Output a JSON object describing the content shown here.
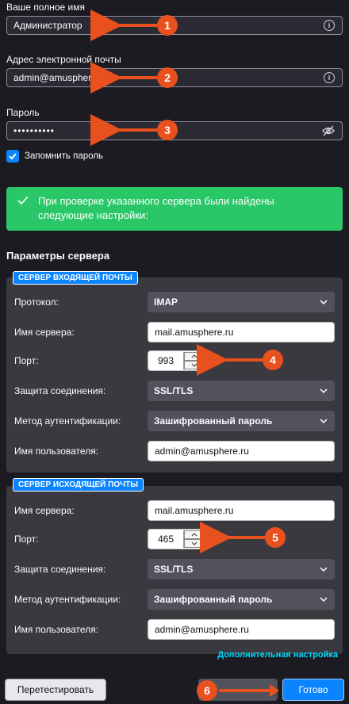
{
  "account": {
    "name_label": "Ваше полное имя",
    "name_value": "Администратор",
    "email_label": "Адрес электронной почты",
    "email_value": "admin@amusphere.ru",
    "password_label": "Пароль",
    "password_value": "••••••••••",
    "remember_label": "Запомнить пароль"
  },
  "notice": {
    "text": "При проверке указанного сервера были найдены следующие настройки:",
    "color": "#2ac769"
  },
  "server_params_title": "Параметры сервера",
  "incoming": {
    "legend": "СЕРВЕР ВХОДЯЩЕЙ ПОЧТЫ",
    "protocol_label": "Протокол:",
    "protocol_value": "IMAP",
    "server_label": "Имя сервера:",
    "server_value": "mail.amusphere.ru",
    "port_label": "Порт:",
    "port_value": "993",
    "security_label": "Защита соединения:",
    "security_value": "SSL/TLS",
    "auth_label": "Метод аутентификации:",
    "auth_value": "Зашифрованный пароль",
    "user_label": "Имя пользователя:",
    "user_value": "admin@amusphere.ru"
  },
  "outgoing": {
    "legend": "СЕРВЕР ИСХОДЯЩЕЙ ПОЧТЫ",
    "server_label": "Имя сервера:",
    "server_value": "mail.amusphere.ru",
    "port_label": "Порт:",
    "port_value": "465",
    "security_label": "Защита соединения:",
    "security_value": "SSL/TLS",
    "auth_label": "Метод аутентификации:",
    "auth_value": "Зашифрованный пароль",
    "user_label": "Имя пользователя:",
    "user_value": "admin@amusphere.ru"
  },
  "advanced_link": "Дополнительная настройка",
  "buttons": {
    "retest": "Перетестировать",
    "done": "Готово"
  },
  "callouts": [
    "1",
    "2",
    "3",
    "4",
    "5",
    "6"
  ],
  "colors": {
    "accent": "#0a84ff",
    "callout": "#e8501e",
    "link": "#00ddff"
  }
}
